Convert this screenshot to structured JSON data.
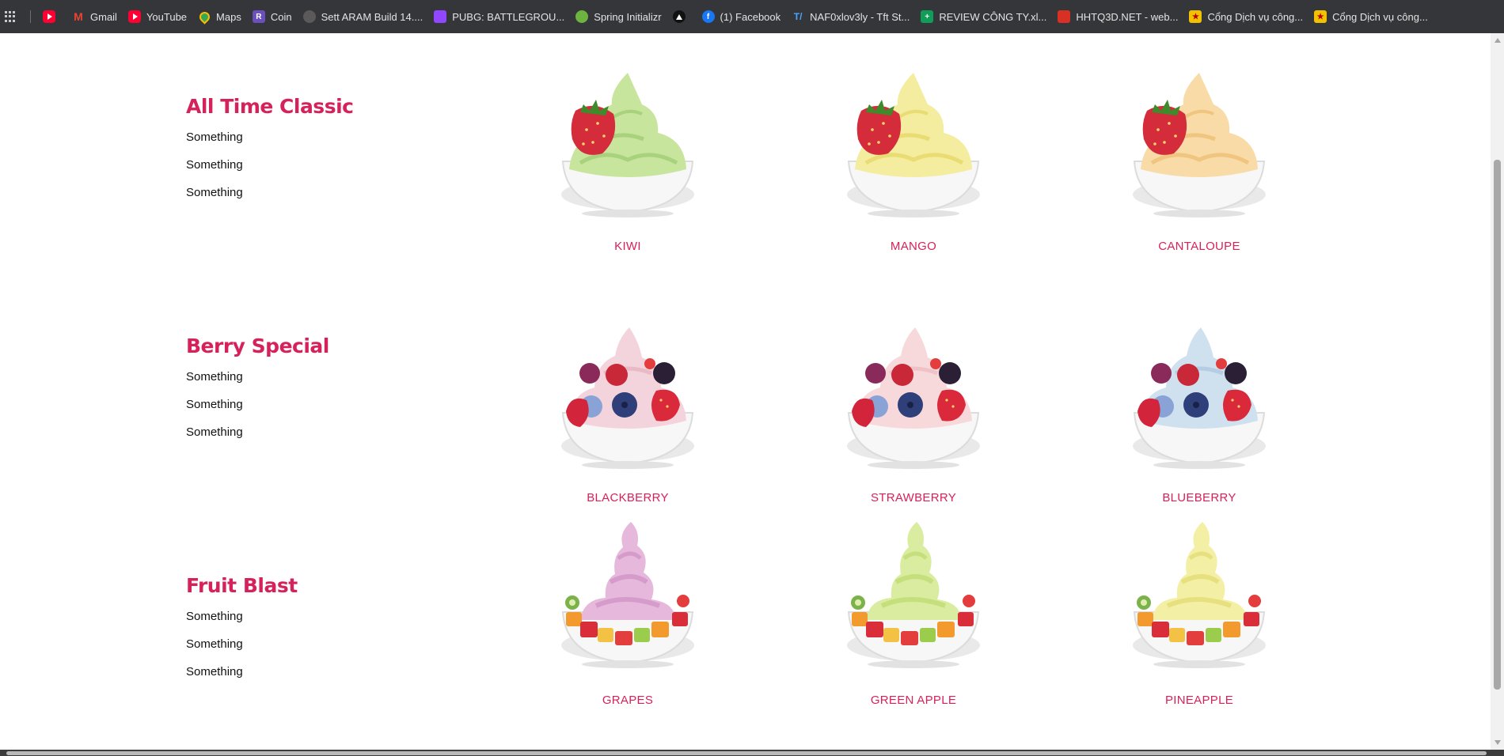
{
  "bookmarks": [
    {
      "label": "",
      "icon": "youtube-icon"
    },
    {
      "label": "Gmail",
      "icon": "gmail-icon"
    },
    {
      "label": "YouTube",
      "icon": "youtube-icon"
    },
    {
      "label": "Maps",
      "icon": "maps-icon"
    },
    {
      "label": "Coin",
      "icon": "coin-icon"
    },
    {
      "label": "Sett ARAM Build 14....",
      "icon": "sett-icon"
    },
    {
      "label": "PUBG: BATTLEGROU...",
      "icon": "twitch-icon"
    },
    {
      "label": "Spring Initializr",
      "icon": "spring-icon"
    },
    {
      "label": "",
      "icon": "triangle-icon"
    },
    {
      "label": "(1) Facebook",
      "icon": "facebook-icon"
    },
    {
      "label": "NAF0xlov3ly - Tft St...",
      "icon": "tft-icon"
    },
    {
      "label": "REVIEW CÔNG TY.xl...",
      "icon": "sheets-icon"
    },
    {
      "label": "HHTQ3D.NET - web...",
      "icon": "hhtq-icon"
    },
    {
      "label": "Cổng Dịch vụ công...",
      "icon": "gov-icon"
    },
    {
      "label": "Cổng Dịch vụ công...",
      "icon": "gov-icon"
    }
  ],
  "categories": [
    {
      "title": "All Time Classic",
      "items": [
        "Something",
        "Something",
        "Something"
      ]
    },
    {
      "title": "Berry Special",
      "items": [
        "Something",
        "Something",
        "Something"
      ]
    },
    {
      "title": "Fruit Blast",
      "items": [
        "Something",
        "Something",
        "Something"
      ]
    }
  ],
  "products": [
    {
      "name": "KIWI",
      "style": "classic",
      "cream": "#c7e59c",
      "cream_dark": "#a8d27b"
    },
    {
      "name": "MANGO",
      "style": "classic",
      "cream": "#f4ec9e",
      "cream_dark": "#e8dc72"
    },
    {
      "name": "CANTALOUPE",
      "style": "classic",
      "cream": "#f8dba6",
      "cream_dark": "#f0c57f"
    },
    {
      "name": "BLACKBERRY",
      "style": "berry",
      "cream": "#f4d4dc",
      "cream_dark": "#e9b9c6"
    },
    {
      "name": "STRAWBERRY",
      "style": "berry",
      "cream": "#f7d9dc",
      "cream_dark": "#efc2c6"
    },
    {
      "name": "BLUEBERRY",
      "style": "berry",
      "cream": "#cfe0ee",
      "cream_dark": "#b4cde2"
    },
    {
      "name": "GRAPES",
      "style": "fruit",
      "cream": "#e6b8dc",
      "cream_dark": "#d59ccb"
    },
    {
      "name": "GREEN APPLE",
      "style": "fruit",
      "cream": "#d9ec9f",
      "cream_dark": "#c5df7c"
    },
    {
      "name": "PINEAPPLE",
      "style": "fruit",
      "cream": "#f3f0a6",
      "cream_dark": "#e6e07f"
    }
  ]
}
